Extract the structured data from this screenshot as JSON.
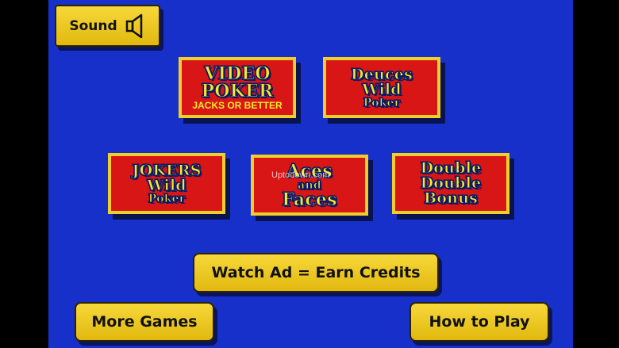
{
  "sound": {
    "label": "Sound",
    "icon": "speaker-icon"
  },
  "games": [
    {
      "line1": "VIDEO",
      "line2": "POKER",
      "line3": "JACKS OR BETTER"
    },
    {
      "line1": "Deuces",
      "line2": "Wild",
      "line3": "Poker"
    },
    {
      "line1": "JOKERS",
      "line2": "Wild",
      "line3": "Poker"
    },
    {
      "line1": "Aces",
      "line2": "and",
      "line3": "Faces"
    },
    {
      "line1": "Double",
      "line2": "Double",
      "line3": "Bonus"
    }
  ],
  "watermark": "Uptodown.com",
  "buttons": {
    "watch_ad": "Watch Ad = Earn Credits",
    "more_games": "More Games",
    "how_to_play": "How to Play"
  },
  "colors": {
    "background": "#1730c9",
    "tile": "#d91616",
    "button": "#f0cf2c"
  }
}
